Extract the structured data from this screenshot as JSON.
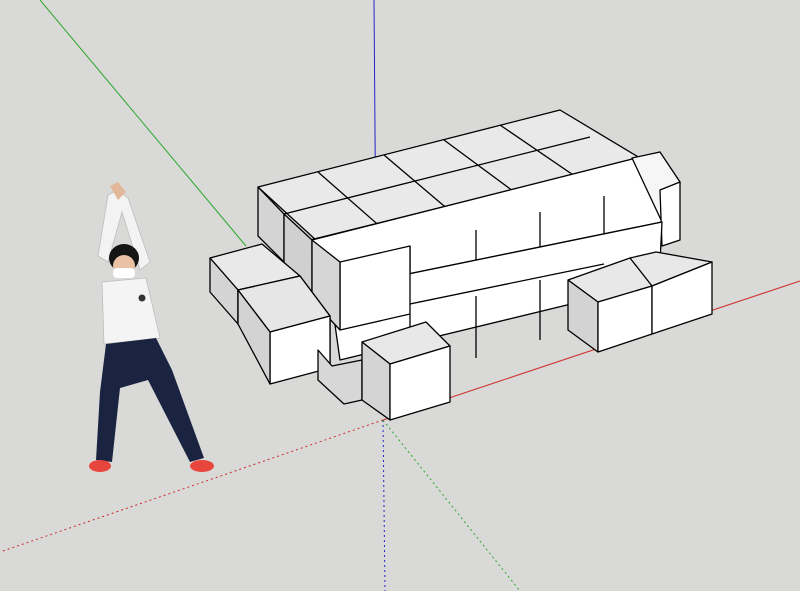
{
  "app": {
    "view": "3d-modeling-viewport",
    "background_color": "#d9d9d7"
  },
  "axes": {
    "red_color": "#cc2a2a",
    "green_color": "#2fa82f",
    "blue_color": "#2424c8"
  },
  "model": {
    "type": "stacked-cube-blocks",
    "face_top_color": "#e8e8e8",
    "face_front_color": "#ffffff",
    "face_side_color": "#d2d2d2",
    "edge_color": "#000000"
  },
  "figure": {
    "type": "person-cutout",
    "icon": "person-icon",
    "jacket_color": "#f4f4f4",
    "jeans_color": "#1a2340",
    "shoe_color": "#e8453c"
  }
}
